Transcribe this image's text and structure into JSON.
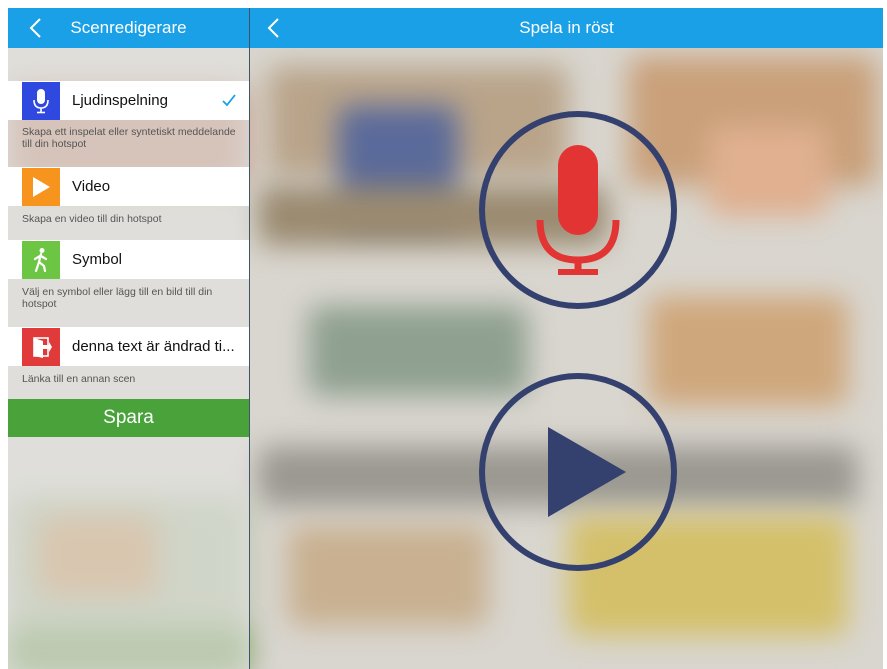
{
  "left_header": {
    "title": "Scenredigerare"
  },
  "right_header": {
    "title": "Spela in röst"
  },
  "options": [
    {
      "label": "Ljudinspelning",
      "description": "Skapa ett inspelat eller syntetiskt meddelande till din hotspot",
      "icon": "microphone-icon",
      "color": "#2e48e0",
      "selected": true
    },
    {
      "label": "Video",
      "description": "Skapa en video till din hotspot",
      "icon": "play-icon",
      "color": "#f7941d",
      "selected": false
    },
    {
      "label": "Symbol",
      "description": "Välj en symbol eller lägg till en bild till din hotspot",
      "icon": "walking-person-icon",
      "color": "#6cc644",
      "selected": false
    },
    {
      "label": "denna text är ändrad ti...",
      "description": "Länka till en annan scen",
      "icon": "door-icon",
      "color": "#e03a3a",
      "selected": false
    }
  ],
  "save_button": {
    "label": "Spara",
    "color": "#4aa23a"
  },
  "colors": {
    "header": "#1aa0e6",
    "record": "#e33434",
    "ring": "#34406e"
  }
}
